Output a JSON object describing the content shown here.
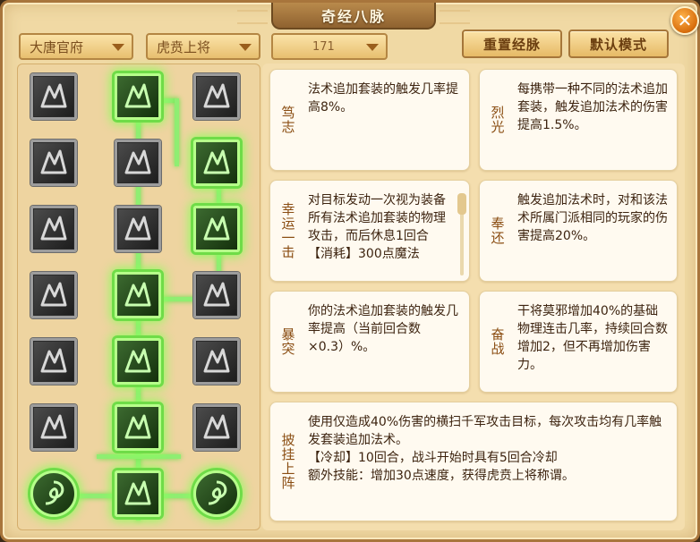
{
  "window": {
    "title": "奇经八脉",
    "close_label": "✕"
  },
  "filters": {
    "faction": "大唐官府",
    "title": "虎贲上将",
    "points": "171"
  },
  "buttons": {
    "reset": "重置经脉",
    "default_mode": "默认模式"
  },
  "colors": {
    "active_glow": "#8bff5a",
    "accent": "#a8753c",
    "text": "#3d2410"
  },
  "tree": {
    "nodes": [
      {
        "icon": "lightning-figure-icon",
        "active": false
      },
      {
        "icon": "running-warrior-icon",
        "active": true
      },
      {
        "icon": "wind-swirl-icon",
        "active": false
      },
      {
        "icon": "burst-figure-icon",
        "active": false
      },
      {
        "icon": "crossed-swords-icon",
        "active": false
      },
      {
        "icon": "slash-strikes-icon",
        "active": true
      },
      {
        "icon": "spinning-slash-icon",
        "active": false
      },
      {
        "icon": "broken-heart-icon",
        "active": false
      },
      {
        "icon": "blade-arc-icon",
        "active": true
      },
      {
        "icon": "paw-strike-icon",
        "active": false
      },
      {
        "icon": "twin-warriors-icon",
        "active": true
      },
      {
        "icon": "dragon-claw-icon",
        "active": false
      },
      {
        "icon": "flying-blades-icon",
        "active": false
      },
      {
        "icon": "sprint-figure-icon",
        "active": true
      },
      {
        "icon": "shattered-heart-icon",
        "active": false
      },
      {
        "icon": "sword-rain-icon",
        "active": false
      },
      {
        "icon": "courage-seal-icon",
        "active": true
      },
      {
        "icon": "scroll-talisman-icon",
        "active": false
      },
      {
        "icon": "serpent-orb-icon",
        "active": true
      },
      {
        "icon": "triple-chevron-icon",
        "active": true
      },
      {
        "icon": "serpent-orb-icon",
        "active": true
      }
    ]
  },
  "skills": [
    {
      "name": "笃志",
      "desc": "法术追加套装的触发几率提高8%。"
    },
    {
      "name": "烈光",
      "desc": "每携带一种不同的法术追加套装，触发追加法术的伤害提高1.5%。"
    },
    {
      "name": "幸运一击",
      "desc": "对目标发动一次视为装备所有法术追加套装的物理攻击，而后休息1回合【消耗】300点魔法"
    },
    {
      "name": "奉还",
      "desc": "触发追加法术时，对和该法术所属门派相同的玩家的伤害提高20%。"
    },
    {
      "name": "暴突",
      "desc": "你的法术追加套装的触发几率提高（当前回合数×0.3）%。"
    },
    {
      "name": "奋战",
      "desc": "干将莫邪增加40%的基础物理连击几率，持续回合数增加2，但不再增加伤害力。"
    },
    {
      "name": "披挂上阵",
      "lines": [
        "使用仅造成40%伤害的横扫千军攻击目标，每次攻击均有几率触发套装追加法术。",
        "【冷却】10回合，战斗开始时具有5回合冷却",
        "额外技能：增加30点速度，获得虎贲上将称谓。"
      ]
    }
  ]
}
